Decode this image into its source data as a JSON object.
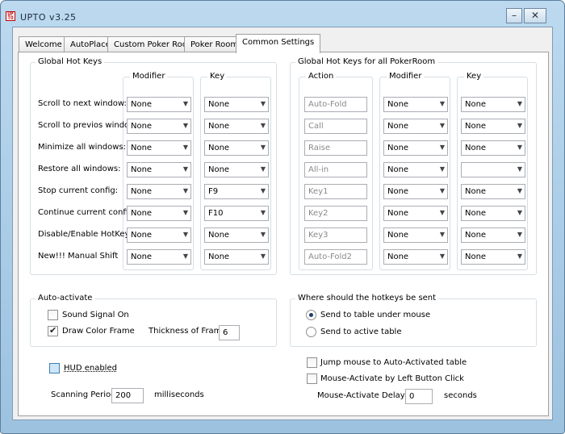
{
  "window": {
    "title": "UPTO  v3.25",
    "logo_text": "UP TO"
  },
  "caption_buttons": {
    "minimize": "–",
    "close": "✕"
  },
  "tabs": [
    {
      "label": "Welcome",
      "active": false
    },
    {
      "label": "AutoPlace",
      "active": false
    },
    {
      "label": "Custom Poker Room",
      "active": false
    },
    {
      "label": "Poker Room",
      "active": false
    },
    {
      "label": "Common Settings",
      "active": true
    }
  ],
  "global_hot_keys": {
    "title": "Global Hot Keys",
    "modifier_header": "Modifier",
    "key_header": "Key",
    "rows": [
      {
        "label": "Scroll to next window:",
        "modifier": "None",
        "key": "None"
      },
      {
        "label": "Scroll to previos window:",
        "modifier": "None",
        "key": "None"
      },
      {
        "label": "Minimize all windows:",
        "modifier": "None",
        "key": "None"
      },
      {
        "label": "Restore all windows:",
        "modifier": "None",
        "key": "None"
      },
      {
        "label": "Stop current config:",
        "modifier": "None",
        "key": "F9"
      },
      {
        "label": "Continue current config:",
        "modifier": "None",
        "key": "F10"
      },
      {
        "label": "Disable/Enable HotKeys:",
        "modifier": "None",
        "key": "None"
      },
      {
        "label": "New!!!  Manual Shift",
        "modifier": "None",
        "key": "None"
      }
    ]
  },
  "pokerroom_hot_keys": {
    "title": "Global Hot Keys for all PokerRoom",
    "action_header": "Action",
    "modifier_header": "Modifier",
    "key_header": "Key",
    "rows": [
      {
        "action": "Auto-Fold",
        "modifier": "None",
        "key": "None"
      },
      {
        "action": "Call",
        "modifier": "None",
        "key": "None"
      },
      {
        "action": "Raise",
        "modifier": "None",
        "key": "None"
      },
      {
        "action": "All-in",
        "modifier": "None",
        "key": ""
      },
      {
        "action": "Key1",
        "modifier": "None",
        "key": "None"
      },
      {
        "action": "Key2",
        "modifier": "None",
        "key": "None"
      },
      {
        "action": "Key3",
        "modifier": "None",
        "key": "None"
      },
      {
        "action": "Auto-Fold2",
        "modifier": "None",
        "key": "None"
      }
    ]
  },
  "auto_activate": {
    "title": "Auto-activate",
    "sound_signal_label": "Sound Signal On",
    "sound_signal_checked": false,
    "draw_color_frame_label": "Draw Color Frame",
    "draw_color_frame_checked": true,
    "thickness_label": "Thickness of Frame:",
    "thickness_value": "6"
  },
  "hotkeys_target": {
    "title": "Where should the hotkeys be sent",
    "options": [
      {
        "label": "Send to table under mouse",
        "selected": true
      },
      {
        "label": "Send to active table",
        "selected": false
      }
    ]
  },
  "hud": {
    "label": "HUD enabled",
    "checked": false
  },
  "scanning": {
    "label": "Scanning Period:",
    "value": "200",
    "unit": "milliseconds"
  },
  "jump_mouse": {
    "label": "Jump mouse to Auto-Activated table",
    "checked": false
  },
  "mouse_activate": {
    "label": "Mouse-Activate by Left Button Click",
    "checked": false
  },
  "mouse_delay": {
    "label": "Mouse-Activate Delay:",
    "value": "0",
    "unit": "seconds"
  },
  "arrow_glyph": "▼"
}
